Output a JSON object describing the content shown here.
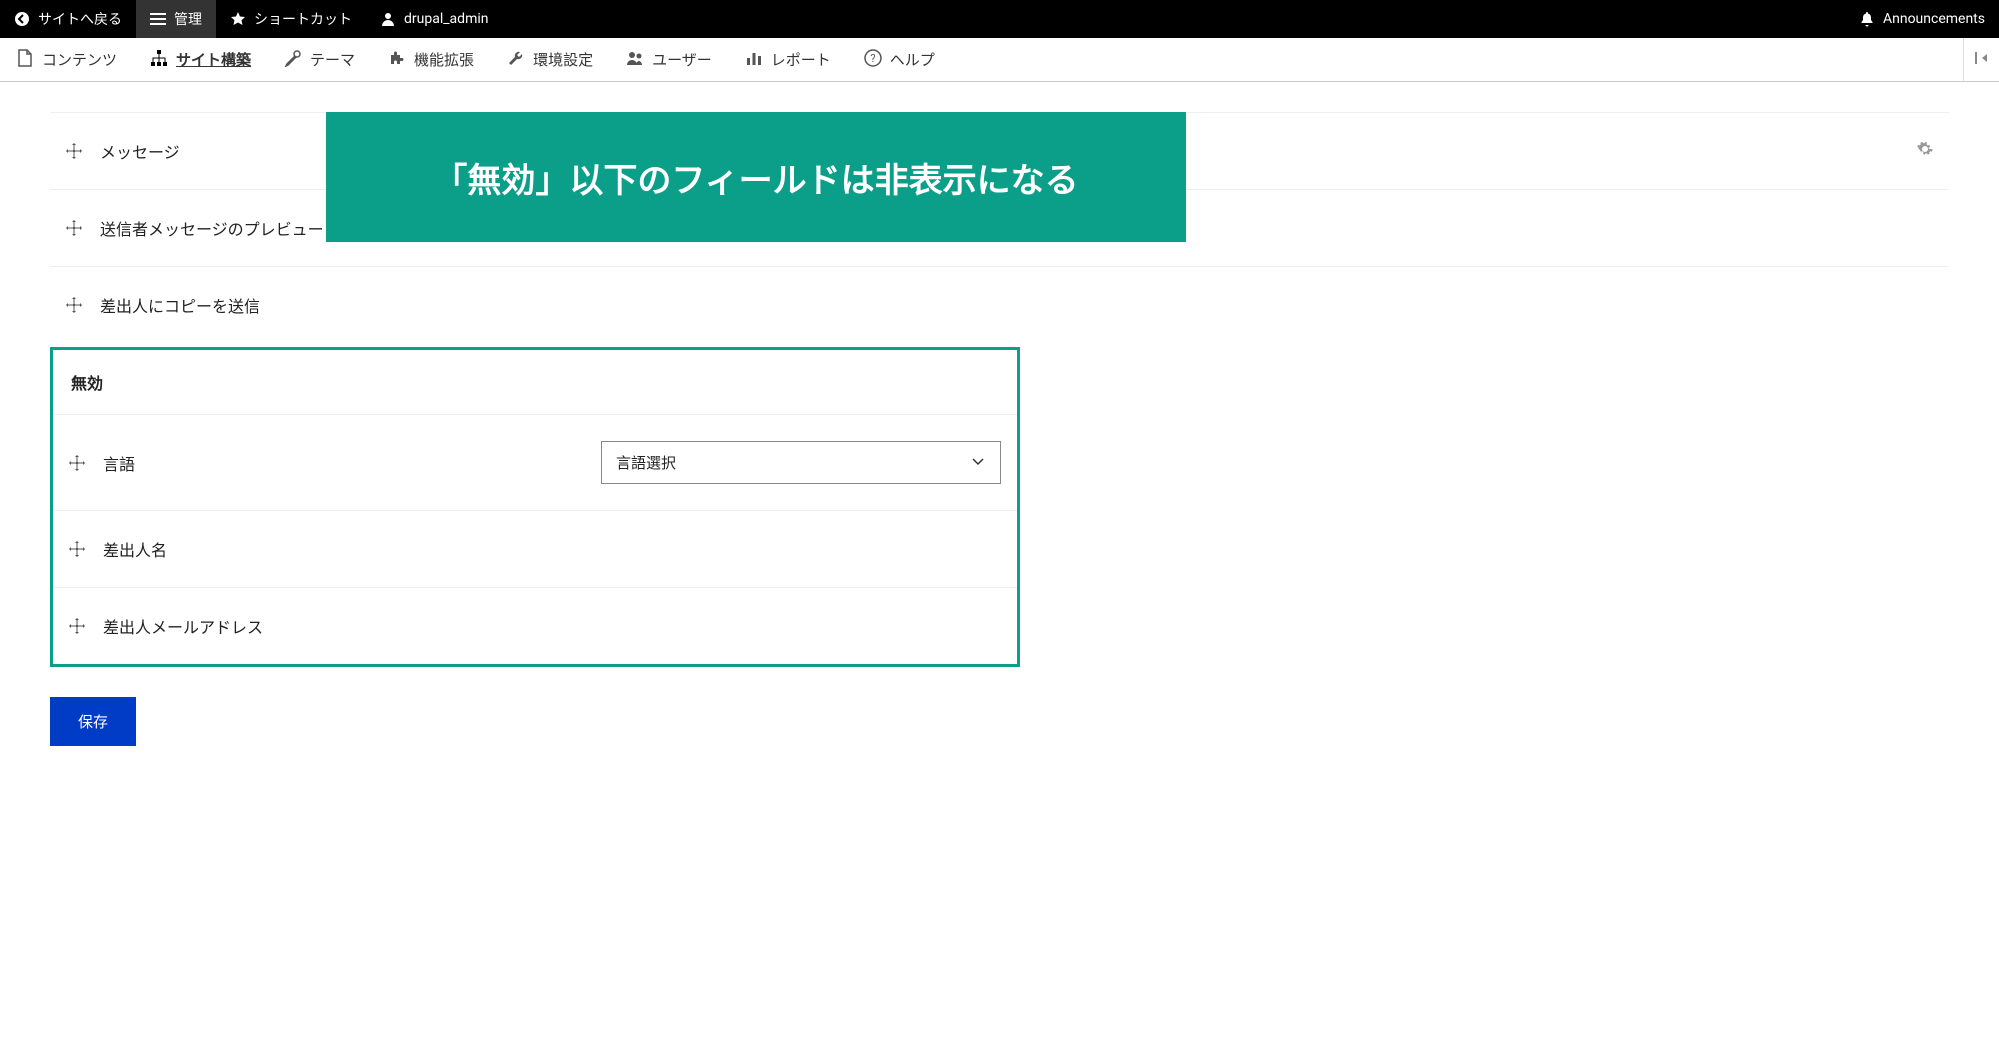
{
  "topbar": {
    "back_label": "サイトへ戻る",
    "manage_label": "管理",
    "shortcut_label": "ショートカット",
    "user_name": "drupal_admin",
    "announcements_label": "Announcements"
  },
  "adminnav": {
    "content": "コンテンツ",
    "structure": "サイト構築",
    "appearance": "テーマ",
    "extend": "機能拡張",
    "config": "環境設定",
    "people": "ユーザー",
    "reports": "レポート",
    "help": "ヘルプ"
  },
  "annotation": "「無効」以下のフィールドは非表示になる",
  "rows": {
    "message": "メッセージ",
    "preview": "送信者メッセージのプレビュー",
    "copy": "差出人にコピーを送信"
  },
  "disabled_section": {
    "header": "無効",
    "language": {
      "label": "言語",
      "select_value": "言語選択"
    },
    "sender_name": "差出人名",
    "sender_email": "差出人メールアドレス"
  },
  "save_label": "保存"
}
